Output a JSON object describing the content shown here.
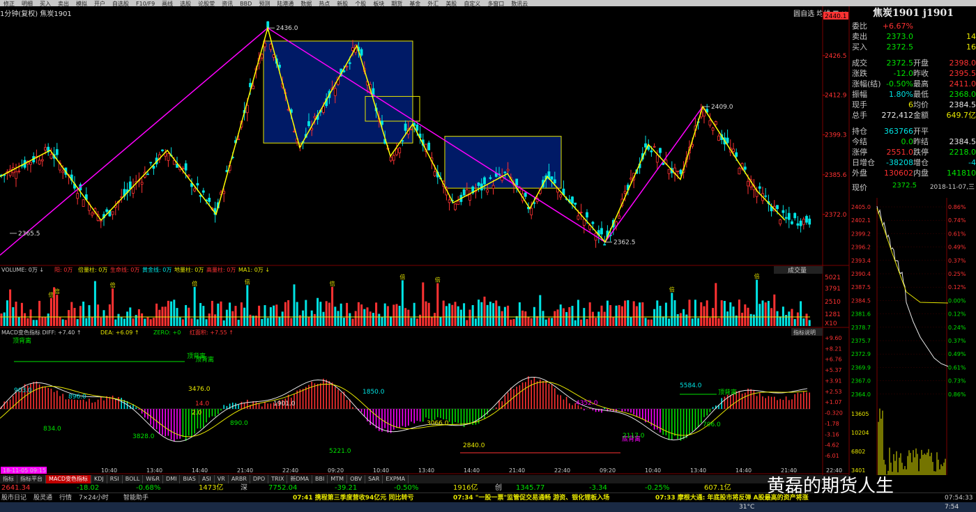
{
  "toolbar": {
    "items": [
      "修正",
      "明细",
      "买入",
      "卖出",
      "模拟",
      "开户",
      "自选股",
      "F10/F9",
      "画线",
      "选股",
      "论股堂",
      "资讯",
      "BBD",
      "预测",
      "陆港通",
      "数据",
      "热点",
      "新股",
      "个股",
      "板块",
      "期货",
      "基金",
      "外汇",
      "美股",
      "自定义",
      "多窗口",
      "数讯云"
    ]
  },
  "window": {
    "title_left": "1分钟(复权)  焦炭1901",
    "title_right": "圆自选  均线  ☰  ✕"
  },
  "quote": {
    "title": "焦炭1901 j1901",
    "rows": [
      {
        "l1": "委比",
        "v1": "+6.67%",
        "c1": "red",
        "l2": "",
        "v2": "",
        "c2": ""
      },
      {
        "l1": "卖出",
        "v1": "2373.0",
        "c1": "green",
        "l2": "",
        "v2": "14",
        "c2": "yellow"
      },
      {
        "l1": "买入",
        "v1": "2372.5",
        "c1": "green",
        "l2": "",
        "v2": "16",
        "c2": "yellow"
      },
      {
        "l1": "成交",
        "v1": "2372.5",
        "c1": "green",
        "l2": "开盘",
        "v2": "2398.0",
        "c2": "red"
      },
      {
        "l1": "涨跌",
        "v1": "-12.0",
        "c1": "green",
        "l2": "昨收",
        "v2": "2395.5",
        "c2": "red"
      },
      {
        "l1": "涨幅(结)",
        "v1": "-0.50%",
        "c1": "green",
        "l2": "最高",
        "v2": "2411.0",
        "c2": "red"
      },
      {
        "l1": "振幅",
        "v1": "1.80%",
        "c1": "cyan",
        "l2": "最低",
        "v2": "2368.0",
        "c2": "green"
      },
      {
        "l1": "现手",
        "v1": "6",
        "c1": "yellow",
        "l2": "均价",
        "v2": "2384.5",
        "c2": "white"
      },
      {
        "l1": "总手",
        "v1": "272,412",
        "c1": "white",
        "l2": "金额",
        "v2": "649.7亿",
        "c2": "yellow"
      },
      {
        "l1": "持仓",
        "v1": "363766",
        "c1": "cyan",
        "l2": "开平",
        "v2": "",
        "c2": ""
      },
      {
        "l1": "今结",
        "v1": "0.0",
        "c1": "green",
        "l2": "昨结",
        "v2": "2384.5",
        "c2": "white"
      },
      {
        "l1": "涨停",
        "v1": "2551.0",
        "c1": "red",
        "l2": "跌停",
        "v2": "2218.0",
        "c2": "green"
      },
      {
        "l1": "日增仓",
        "v1": "-38208",
        "c1": "cyan",
        "l2": "增仓",
        "v2": "-4",
        "c2": "cyan"
      },
      {
        "l1": "外盘",
        "v1": "130602",
        "c1": "red",
        "l2": "内盘",
        "v2": "141810",
        "c2": "green"
      }
    ],
    "trade_label": "现价",
    "trade_price": "2372.5",
    "trade_time": "2018-11-07,三"
  },
  "chart_data": [
    {
      "type": "candlestick",
      "title": "1分钟(复权)  焦炭1901",
      "y_ticks": [
        "2440.1",
        "2426.5",
        "2412.9",
        "2399.3",
        "2385.6",
        "2372.0"
      ],
      "ylim": [
        2362.5,
        2440.1
      ],
      "key_points": [
        {
          "label": "2365.5",
          "value": 2365.5
        },
        {
          "label": "2436.0",
          "value": 2436.0
        },
        {
          "label": "2362.5",
          "value": 2362.5
        },
        {
          "label": "2409.0",
          "value": 2409.0
        }
      ],
      "wave_points": [
        2385,
        2394,
        2370,
        2394,
        2372,
        2436,
        2395,
        2430,
        2392,
        2403,
        2376,
        2386,
        2374,
        2385,
        2362.5,
        2396,
        2384,
        2409,
        2380,
        2370
      ],
      "trend_points": [
        2358,
        2436,
        2362.5,
        2409
      ]
    },
    {
      "type": "bar",
      "title": "VOLUME: 0万",
      "legend": [
        "VOLUME: 0万 ↓",
        "阳: 0万",
        "倍量柱: 0万",
        "生命线: 0万",
        "黄金线: 0万",
        "地量柱: 0万",
        "高量柱: 0万",
        "MA1: 0万 ↓"
      ],
      "y_ticks": [
        "5021",
        "3791",
        "2510",
        "1281",
        "X10"
      ],
      "axis_button": "成交量",
      "bar_label": "倍"
    },
    {
      "type": "bar",
      "title": "MACD变色指标",
      "legend": [
        "MACD变色指标  DIFF: +7.40 ↑",
        "DEA: +6.09 ↑",
        "ZERO: +0",
        "红面积: +7.55 ↑"
      ],
      "axis_button": "指标说明",
      "y_ticks": [
        "+9.60",
        "+8.21",
        "+6.76",
        "+5.37",
        "+3.91",
        "+2.53",
        "+1.07",
        "-0.320",
        "-1.78",
        "-3.16",
        "-4.62",
        "-6.01"
      ],
      "annotations": [
        {
          "text": "顶背离"
        },
        {
          "text": "顶背离"
        },
        {
          "text": "顶背离"
        },
        {
          "text": "底背离"
        },
        {
          "text": "顶背离"
        },
        {
          "text": "903.0"
        },
        {
          "text": "896.0"
        },
        {
          "text": "834.0"
        },
        {
          "text": "3828.0"
        },
        {
          "text": "3476.0"
        },
        {
          "text": "14.0"
        },
        {
          "text": "2.0"
        },
        {
          "text": "890.0"
        },
        {
          "text": "1901.0"
        },
        {
          "text": "5221.0"
        },
        {
          "text": "1850.0"
        },
        {
          "text": "3066.0"
        },
        {
          "text": "2840.0"
        },
        {
          "text": "4352.0"
        },
        {
          "text": "2117.0"
        },
        {
          "text": "5584.0"
        },
        {
          "text": "706.0"
        }
      ],
      "x_ticks": [
        "18-11-05 09:15",
        "10:40",
        "13:40",
        "14:40",
        "21:40",
        "22:40",
        "09:20",
        "10:40",
        "13:40",
        "14:40",
        "21:40",
        "22:40",
        "09:20",
        "10:40",
        "13:40",
        "14:40",
        "21:40",
        "22:40"
      ]
    }
  ],
  "intraday": {
    "y_ticks_left": [
      "2405.0",
      "2402.1",
      "2399.2",
      "2396.2",
      "2393.4",
      "2390.4",
      "2387.5",
      "2384.5",
      "2381.6",
      "2378.7",
      "2375.7",
      "2372.9",
      "2369.9",
      "2367.0",
      "2364.0",
      "13605",
      "10204",
      "6802",
      "3401"
    ],
    "y_ticks_right": [
      "0.86%",
      "0.74%",
      "0.61%",
      "0.49%",
      "0.37%",
      "0.25%",
      "0.12%",
      "0.00%",
      "0.12%",
      "0.24%",
      "0.37%",
      "0.49%",
      "0.61%",
      "0.73%",
      "0.86%"
    ]
  },
  "tabs": [
    "指标",
    "指标平台",
    "MACD变色指标",
    "KDJ",
    "RSI",
    "BOLL",
    "W&R",
    "DMI",
    "BIAS",
    "ASI",
    "VR",
    "ARBR",
    "DPO",
    "TRIX",
    "新DMA",
    "BBI",
    "MTM",
    "OBV",
    "SAR",
    "EXPMA"
  ],
  "indexbar": [
    "2641.34",
    "-18.02",
    "-0.68%",
    "1473亿",
    "深",
    "7752.04",
    "-39.21",
    "-0.50%",
    "1916亿",
    "创",
    "1345.77",
    "-3.34",
    "-0.25%",
    "607.1亿"
  ],
  "ticker": {
    "left_tabs": [
      "股市日记",
      "股灵通",
      "行情",
      "7×24小时",
      "智能助手"
    ],
    "news": [
      "07:41 携程第三季度营收94亿元 同比转亏",
      "07:34 \"一股一票\"监管促交易通畅 游资、银化锂板入场",
      "07:33 摩根大通: 年底股市将反弹 A股最高的资产将涨"
    ],
    "time": "07:54:33"
  },
  "taskbar": {
    "temp": "31°C",
    "clock": "7:54"
  },
  "watermark": "黄磊的期货人生",
  "colors": {
    "up": "#ff3232",
    "down": "#00e4e4",
    "wave": "#ffff00",
    "trend": "#ff00ff",
    "box": "#001a66"
  }
}
